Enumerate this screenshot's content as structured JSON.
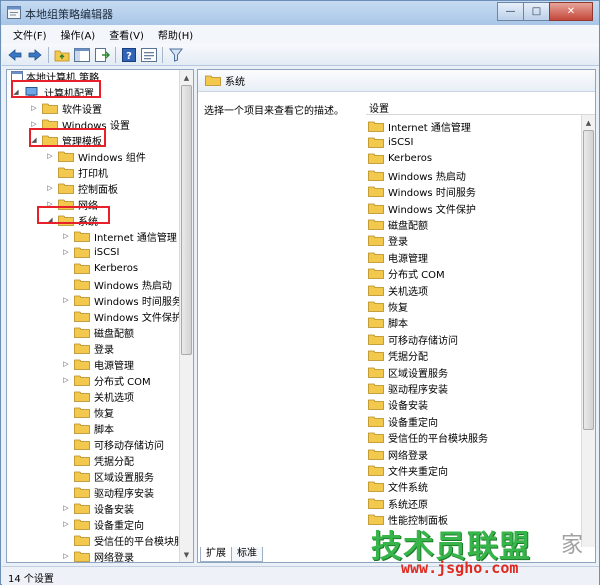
{
  "window": {
    "title": "本地组策略编辑器"
  },
  "menu": [
    "文件(F)",
    "操作(A)",
    "查看(V)",
    "帮助(H)"
  ],
  "toolbar": [
    "back-icon",
    "forward-icon",
    "up-folder-icon",
    "show-hide-tree-icon",
    "export-list-icon",
    "help-icon",
    "properties-icon",
    "filter-icon"
  ],
  "tree": {
    "root": "本地计算机 策略",
    "computer_config": "计算机配置",
    "software_settings": "软件设置",
    "windows_settings": "Windows 设置",
    "admin_templates": "管理模板",
    "windows_components": "Windows 组件",
    "printers": "打印机",
    "control_panel": "控制面板",
    "network": "网络",
    "system": "系统",
    "system_children": [
      "Internet 通信管理",
      "iSCSI",
      "Kerberos",
      "Windows 热启动",
      "Windows 时间服务",
      "Windows 文件保护",
      "磁盘配额",
      "登录",
      "电源管理",
      "分布式 COM",
      "关机选项",
      "恢复",
      "脚本",
      "可移动存储访问",
      "凭据分配",
      "区域设置服务",
      "驱动程序安装",
      "设备安装",
      "设备重定向",
      "受信任的平台模块服务",
      "网络登录"
    ]
  },
  "right_pane": {
    "header": "系统",
    "description": "选择一个项目来查看它的描述。",
    "column_header": "设置",
    "items": [
      "Internet 通信管理",
      "iSCSI",
      "Kerberos",
      "Windows 热启动",
      "Windows 时间服务",
      "Windows 文件保护",
      "磁盘配额",
      "登录",
      "电源管理",
      "分布式 COM",
      "关机选项",
      "恢复",
      "脚本",
      "可移动存储访问",
      "凭据分配",
      "区域设置服务",
      "驱动程序安装",
      "设备安装",
      "设备重定向",
      "受信任的平台模块服务",
      "网络登录",
      "文件夹重定向",
      "文件系统",
      "系统还原",
      "性能控制面板"
    ],
    "tabs": [
      "扩展",
      "标准"
    ]
  },
  "status": "14 个设置",
  "watermark": {
    "main": "技术员联盟",
    "side": "家",
    "url": "www.jsgho.com"
  },
  "colors": {
    "highlight": "#e8202a",
    "folder": "#f2c94c",
    "watermark_green": "#38b54a",
    "watermark_red": "#e02a20"
  }
}
